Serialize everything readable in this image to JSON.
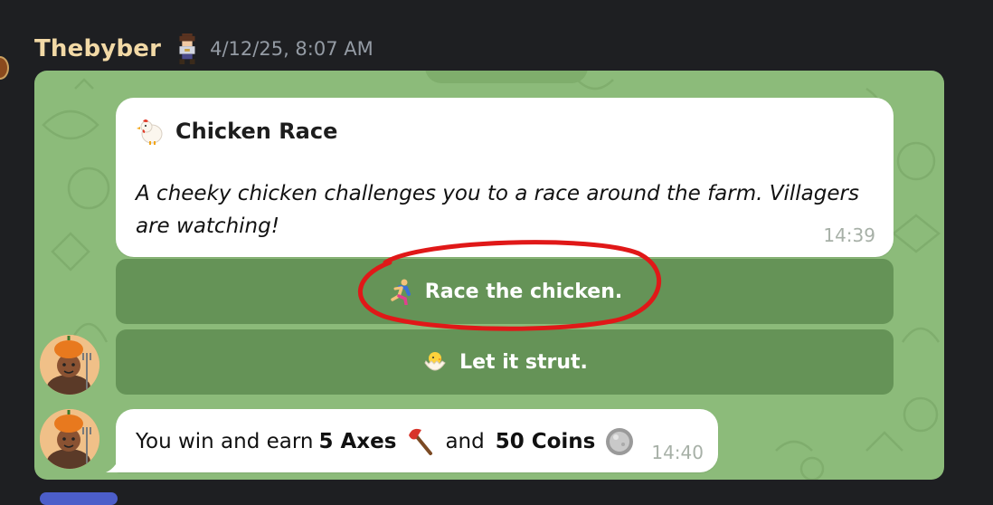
{
  "header": {
    "username": "Thebyber",
    "timestamp": "4/12/25, 8:07 AM"
  },
  "card": {
    "title": "Chicken Race",
    "description": "A cheeky chicken challenges you to a race around the farm. Villagers are watching!",
    "time": "14:39"
  },
  "buttons": [
    {
      "label": "Race the chicken.",
      "icon": "runner-icon"
    },
    {
      "label": "Let it strut.",
      "icon": "hatching-chick-icon"
    }
  ],
  "reply": {
    "text_pre": "You win and earn",
    "axes": "5 Axes",
    "text_mid": "and",
    "coins": "50 Coins",
    "time": "14:40"
  },
  "colors": {
    "background": "#1e1f22",
    "embed_bg": "#8cbb7a",
    "button_bg": "#6e9a5e",
    "annotation": "#e01818",
    "username": "#f2d9a6"
  }
}
